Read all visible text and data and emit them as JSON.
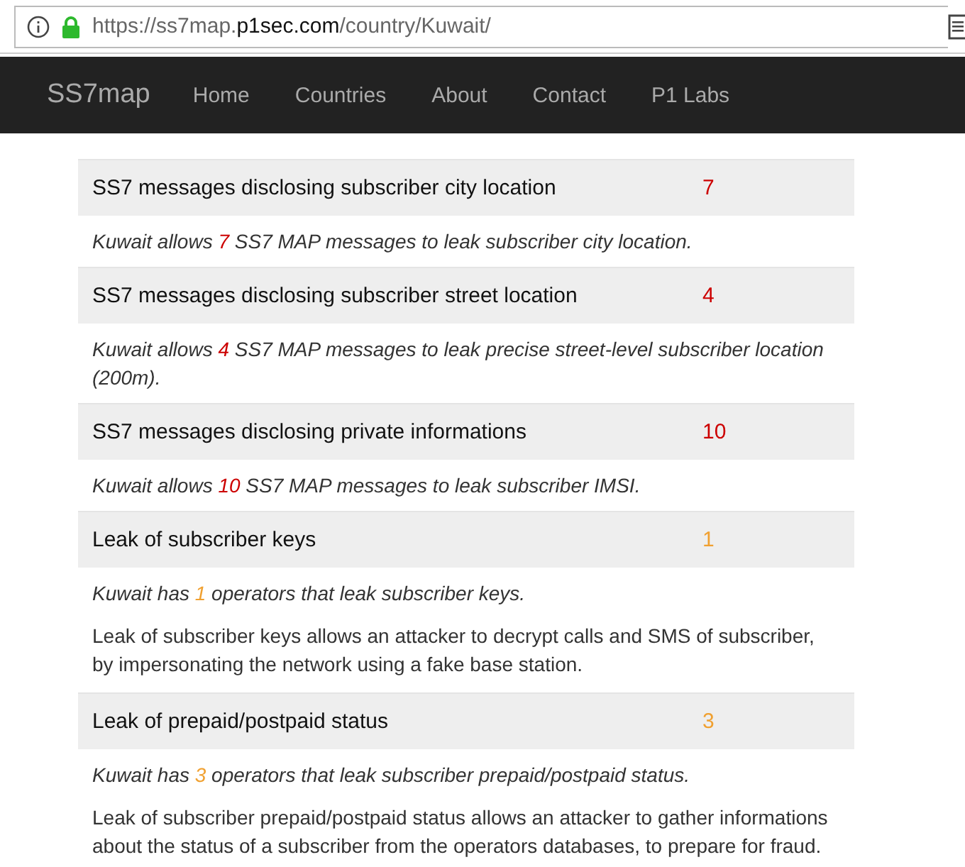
{
  "address_bar": {
    "url_parts": [
      {
        "text": "https://ss7map.",
        "kind": "dim"
      },
      {
        "text": "p1sec.com",
        "kind": "strong"
      },
      {
        "text": "/country/Kuwait/",
        "kind": "dim"
      }
    ]
  },
  "navbar": {
    "brand": "SS7map",
    "links": [
      "Home",
      "Countries",
      "About",
      "Contact",
      "P1 Labs"
    ]
  },
  "sections": [
    {
      "title": "SS7 messages disclosing subscriber city location",
      "count": "7",
      "color": "#cc0000",
      "detail": {
        "before": "Kuwait allows ",
        "count": "7",
        "after": " SS7 MAP messages to leak subscriber city location."
      }
    },
    {
      "title": "SS7 messages disclosing subscriber street location",
      "count": "4",
      "color": "#cc0000",
      "detail": {
        "before": "Kuwait allows ",
        "count": "4",
        "after": " SS7 MAP messages to leak precise street-level subscriber location (200m)."
      }
    },
    {
      "title": "SS7 messages disclosing private informations",
      "count": "10",
      "color": "#cc0000",
      "detail": {
        "before": "Kuwait allows ",
        "count": "10",
        "after": " SS7 MAP messages to leak subscriber IMSI."
      }
    },
    {
      "title": "Leak of subscriber keys",
      "count": "1",
      "color": "#f0a030",
      "detail": {
        "before": "Kuwait has ",
        "count": "1",
        "after": " operators that leak subscriber keys."
      },
      "description": "Leak of subscriber keys allows an attacker to decrypt calls and SMS of subscriber, by impersonating the network using a fake base station."
    },
    {
      "title": "Leak of prepaid/postpaid status",
      "count": "3",
      "color": "#f0a030",
      "detail": {
        "before": "Kuwait has ",
        "count": "3",
        "after": " operators that leak subscriber prepaid/postpaid status."
      },
      "description": "Leak of subscriber prepaid/postpaid status allows an attacker to gather informations about the status of a subscriber from the operators databases, to prepare for fraud."
    }
  ]
}
